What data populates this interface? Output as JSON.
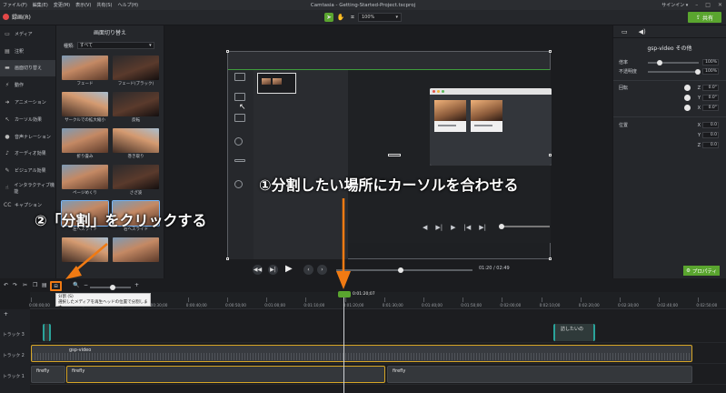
{
  "menubar": {
    "items": [
      "ファイル(F)",
      "編集(E)",
      "変更(M)",
      "表示(V)",
      "共有(S)",
      "ヘルプ(H)"
    ],
    "document_title": "Camtasia - Getting-Started-Project.tscproj",
    "signin": "サインイン ▾"
  },
  "toolbar": {
    "record_label": "録画(R)",
    "zoom_value": "100%",
    "share_label": "共有",
    "colors": {
      "accent": "#5aa52f",
      "record": "#e34848"
    }
  },
  "sidebar": {
    "items": [
      {
        "label": "メディア",
        "icon": "media-icon"
      },
      {
        "label": "注釈",
        "icon": "annotation-icon"
      },
      {
        "label": "画面切り替え",
        "icon": "transition-icon"
      },
      {
        "label": "動作",
        "icon": "behavior-icon"
      },
      {
        "label": "アニメーション",
        "icon": "animation-icon"
      },
      {
        "label": "カーソル効果",
        "icon": "cursor-icon"
      },
      {
        "label": "音声ナレーション",
        "icon": "mic-icon"
      },
      {
        "label": "オーディオ効果",
        "icon": "audio-icon"
      },
      {
        "label": "ビジュアル効果",
        "icon": "visual-icon"
      },
      {
        "label": "インタラクティブ機能",
        "icon": "interactive-icon"
      },
      {
        "label": "キャプション",
        "icon": "cc-icon"
      }
    ]
  },
  "transitions": {
    "title": "画面切り替え",
    "filter_label": "種類:",
    "filter_value": "すべて",
    "items": [
      "フェード",
      "フェード(ブラック)",
      "サークルでの拡大縮小",
      "反転",
      "折り畳み",
      "巻き取り",
      "ページめくり",
      "さざ波",
      "左へスライド",
      "右へスライド",
      "",
      ""
    ]
  },
  "playback": {
    "time_display": "01:20 / 02:49"
  },
  "properties": {
    "title": "gsp-video その他",
    "scale_label": "倍率",
    "scale_value": "100%",
    "opacity_label": "不透明度",
    "opacity_value": "100%",
    "rotation_label": "回転",
    "rotation": {
      "z": "0.0°",
      "y": "0.0°",
      "x": "0.0°"
    },
    "position_label": "位置",
    "position": {
      "x": "0.0",
      "y": "0.0",
      "z": "0.0"
    },
    "button_label": "プロパティ"
  },
  "timeline": {
    "tooltip_title": "分割 (S)",
    "tooltip_body": "選択したメディアを再生ヘッドの位置で分割します。",
    "playhead_time": "0:01:20;07",
    "ruler": [
      "0:00:00;00",
      "0:00:10;00",
      "0:00:20;00",
      "0:00:30;00",
      "0:00:40;00",
      "0:00:50;00",
      "0:01:00;00",
      "0:01:10;00",
      "0:01:20;00",
      "0:01:30;00",
      "0:01:40;00",
      "0:01:50;00",
      "0:02:00;00",
      "0:02:10;00",
      "0:02:20;00",
      "0:02:30;00",
      "0:02:40;00",
      "0:02:50;00"
    ],
    "tracks": [
      {
        "label": "トラック 3",
        "clips": [
          "",
          "訪したいの"
        ]
      },
      {
        "label": "トラック 2",
        "clips": [
          "gsp-video"
        ]
      },
      {
        "label": "トラック 1",
        "clips": [
          "firefly",
          "firefly",
          "firefly"
        ]
      }
    ]
  },
  "annotations": {
    "step1": "①分割したい場所にカーソルを合わせる",
    "step2": "②「分割」をクリックする",
    "arrow_color": "#f07a13"
  }
}
